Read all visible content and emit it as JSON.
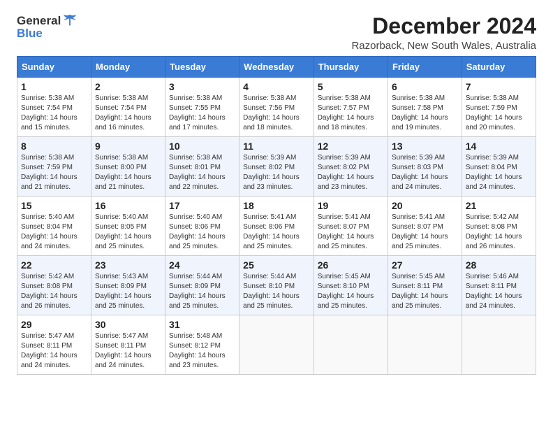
{
  "header": {
    "logo_general": "General",
    "logo_blue": "Blue",
    "title": "December 2024",
    "subtitle": "Razorback, New South Wales, Australia"
  },
  "columns": [
    "Sunday",
    "Monday",
    "Tuesday",
    "Wednesday",
    "Thursday",
    "Friday",
    "Saturday"
  ],
  "weeks": [
    [
      {
        "day": "1",
        "content": "Sunrise: 5:38 AM\nSunset: 7:54 PM\nDaylight: 14 hours\nand 15 minutes."
      },
      {
        "day": "2",
        "content": "Sunrise: 5:38 AM\nSunset: 7:54 PM\nDaylight: 14 hours\nand 16 minutes."
      },
      {
        "day": "3",
        "content": "Sunrise: 5:38 AM\nSunset: 7:55 PM\nDaylight: 14 hours\nand 17 minutes."
      },
      {
        "day": "4",
        "content": "Sunrise: 5:38 AM\nSunset: 7:56 PM\nDaylight: 14 hours\nand 18 minutes."
      },
      {
        "day": "5",
        "content": "Sunrise: 5:38 AM\nSunset: 7:57 PM\nDaylight: 14 hours\nand 18 minutes."
      },
      {
        "day": "6",
        "content": "Sunrise: 5:38 AM\nSunset: 7:58 PM\nDaylight: 14 hours\nand 19 minutes."
      },
      {
        "day": "7",
        "content": "Sunrise: 5:38 AM\nSunset: 7:59 PM\nDaylight: 14 hours\nand 20 minutes."
      }
    ],
    [
      {
        "day": "8",
        "content": "Sunrise: 5:38 AM\nSunset: 7:59 PM\nDaylight: 14 hours\nand 21 minutes."
      },
      {
        "day": "9",
        "content": "Sunrise: 5:38 AM\nSunset: 8:00 PM\nDaylight: 14 hours\nand 21 minutes."
      },
      {
        "day": "10",
        "content": "Sunrise: 5:38 AM\nSunset: 8:01 PM\nDaylight: 14 hours\nand 22 minutes."
      },
      {
        "day": "11",
        "content": "Sunrise: 5:39 AM\nSunset: 8:02 PM\nDaylight: 14 hours\nand 23 minutes."
      },
      {
        "day": "12",
        "content": "Sunrise: 5:39 AM\nSunset: 8:02 PM\nDaylight: 14 hours\nand 23 minutes."
      },
      {
        "day": "13",
        "content": "Sunrise: 5:39 AM\nSunset: 8:03 PM\nDaylight: 14 hours\nand 24 minutes."
      },
      {
        "day": "14",
        "content": "Sunrise: 5:39 AM\nSunset: 8:04 PM\nDaylight: 14 hours\nand 24 minutes."
      }
    ],
    [
      {
        "day": "15",
        "content": "Sunrise: 5:40 AM\nSunset: 8:04 PM\nDaylight: 14 hours\nand 24 minutes."
      },
      {
        "day": "16",
        "content": "Sunrise: 5:40 AM\nSunset: 8:05 PM\nDaylight: 14 hours\nand 25 minutes."
      },
      {
        "day": "17",
        "content": "Sunrise: 5:40 AM\nSunset: 8:06 PM\nDaylight: 14 hours\nand 25 minutes."
      },
      {
        "day": "18",
        "content": "Sunrise: 5:41 AM\nSunset: 8:06 PM\nDaylight: 14 hours\nand 25 minutes."
      },
      {
        "day": "19",
        "content": "Sunrise: 5:41 AM\nSunset: 8:07 PM\nDaylight: 14 hours\nand 25 minutes."
      },
      {
        "day": "20",
        "content": "Sunrise: 5:41 AM\nSunset: 8:07 PM\nDaylight: 14 hours\nand 25 minutes."
      },
      {
        "day": "21",
        "content": "Sunrise: 5:42 AM\nSunset: 8:08 PM\nDaylight: 14 hours\nand 26 minutes."
      }
    ],
    [
      {
        "day": "22",
        "content": "Sunrise: 5:42 AM\nSunset: 8:08 PM\nDaylight: 14 hours\nand 26 minutes."
      },
      {
        "day": "23",
        "content": "Sunrise: 5:43 AM\nSunset: 8:09 PM\nDaylight: 14 hours\nand 25 minutes."
      },
      {
        "day": "24",
        "content": "Sunrise: 5:44 AM\nSunset: 8:09 PM\nDaylight: 14 hours\nand 25 minutes."
      },
      {
        "day": "25",
        "content": "Sunrise: 5:44 AM\nSunset: 8:10 PM\nDaylight: 14 hours\nand 25 minutes."
      },
      {
        "day": "26",
        "content": "Sunrise: 5:45 AM\nSunset: 8:10 PM\nDaylight: 14 hours\nand 25 minutes."
      },
      {
        "day": "27",
        "content": "Sunrise: 5:45 AM\nSunset: 8:11 PM\nDaylight: 14 hours\nand 25 minutes."
      },
      {
        "day": "28",
        "content": "Sunrise: 5:46 AM\nSunset: 8:11 PM\nDaylight: 14 hours\nand 24 minutes."
      }
    ],
    [
      {
        "day": "29",
        "content": "Sunrise: 5:47 AM\nSunset: 8:11 PM\nDaylight: 14 hours\nand 24 minutes."
      },
      {
        "day": "30",
        "content": "Sunrise: 5:47 AM\nSunset: 8:11 PM\nDaylight: 14 hours\nand 24 minutes."
      },
      {
        "day": "31",
        "content": "Sunrise: 5:48 AM\nSunset: 8:12 PM\nDaylight: 14 hours\nand 23 minutes."
      },
      {
        "day": "",
        "content": ""
      },
      {
        "day": "",
        "content": ""
      },
      {
        "day": "",
        "content": ""
      },
      {
        "day": "",
        "content": ""
      }
    ]
  ]
}
